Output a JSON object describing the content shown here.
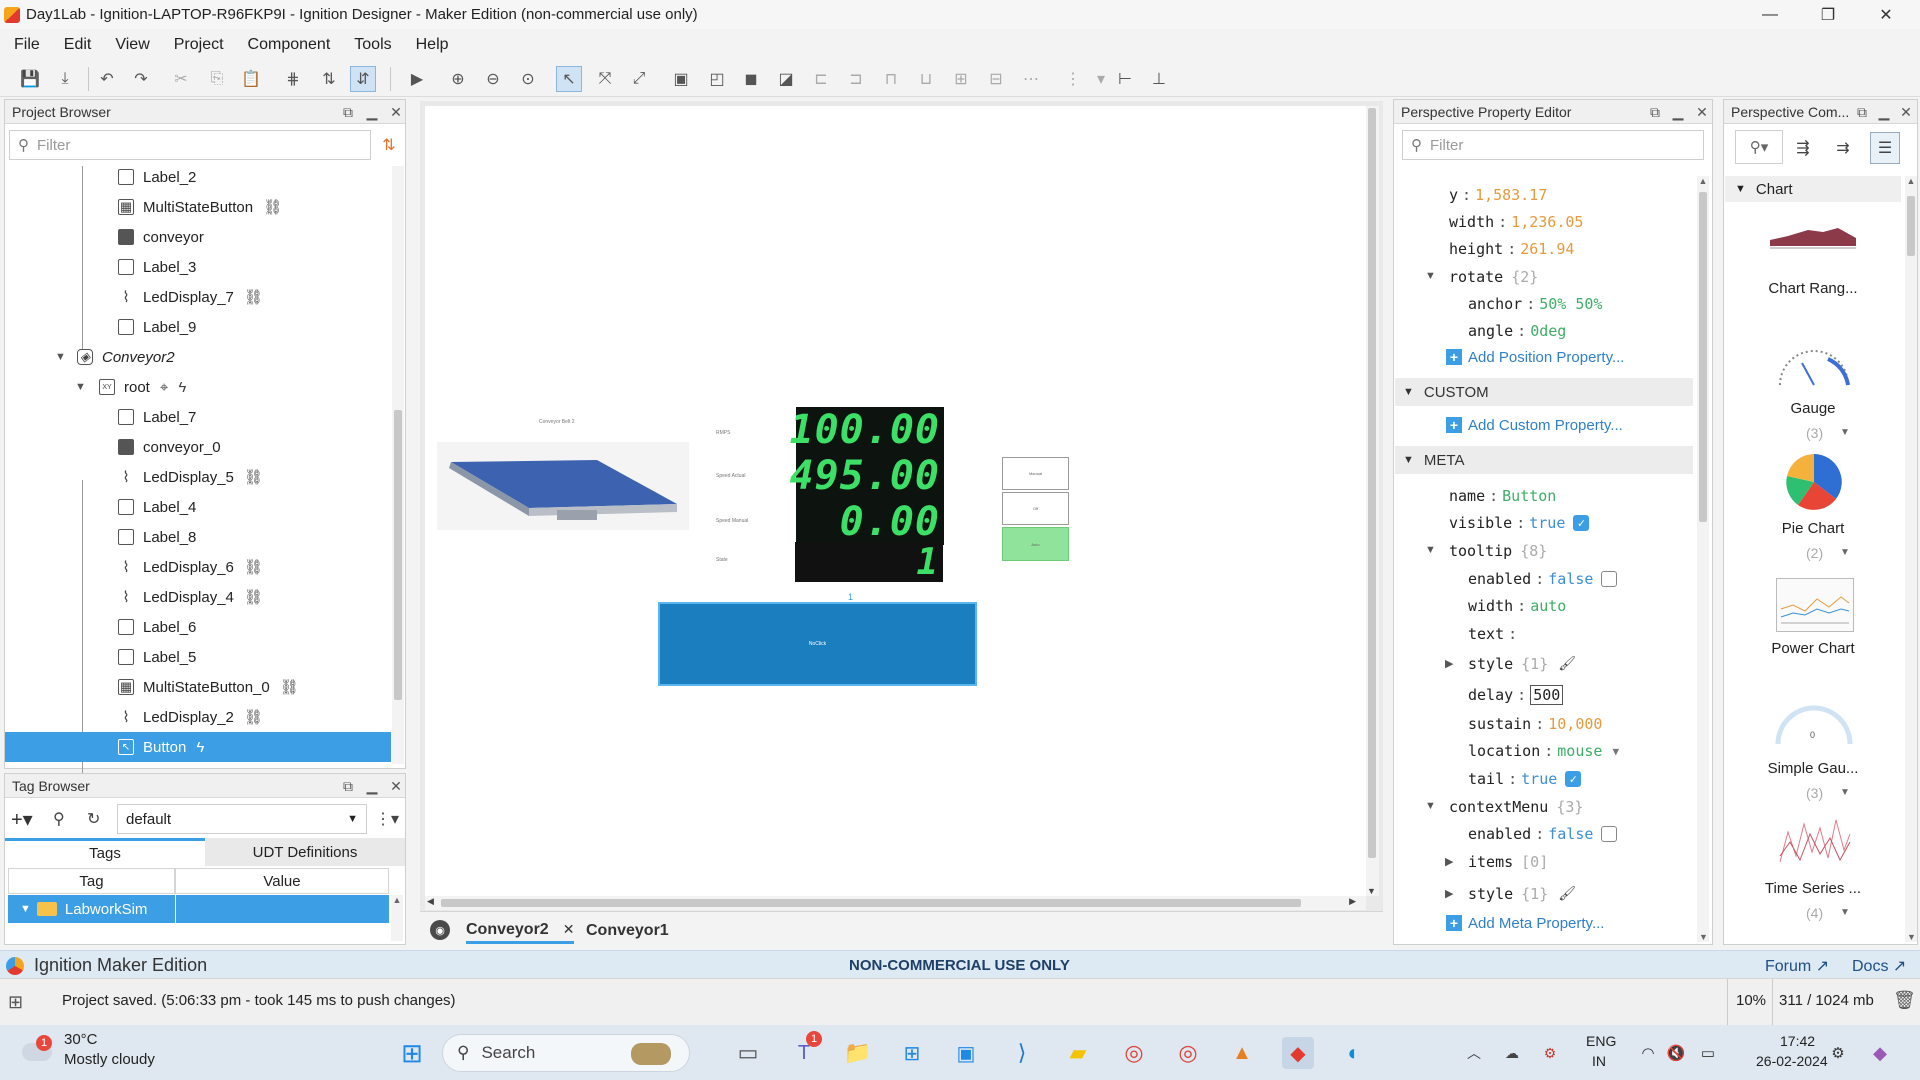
{
  "window": {
    "title": "Day1Lab - Ignition-LAPTOP-R96FKP9I - Ignition Designer - Maker Edition (non-commercial use only)",
    "controls": {
      "minimize": "—",
      "maximize": "❐",
      "close": "✕"
    }
  },
  "menubar": {
    "items": [
      {
        "label": "File"
      },
      {
        "label": "Edit"
      },
      {
        "label": "View"
      },
      {
        "label": "Project"
      },
      {
        "label": "Component"
      },
      {
        "label": "Tools"
      },
      {
        "label": "Help"
      }
    ]
  },
  "project_browser": {
    "title": "Project Browser",
    "filter_placeholder": "Filter",
    "items": [
      {
        "label": "Label_2",
        "icon": "label-icon"
      },
      {
        "label": "MultiStateButton",
        "icon": "multistate-icon",
        "link": true
      },
      {
        "label": "conveyor",
        "icon": "image-icon"
      },
      {
        "label": "Label_3",
        "icon": "label-icon"
      },
      {
        "label": "LedDisplay_7",
        "icon": "led-icon",
        "link": true
      },
      {
        "label": "Label_9",
        "icon": "label-icon"
      },
      {
        "label": "Conveyor2",
        "icon": "view-icon"
      },
      {
        "label": "root",
        "icon": "xy-container-icon"
      },
      {
        "label": "Label_7",
        "icon": "label-icon"
      },
      {
        "label": "conveyor_0",
        "icon": "image-icon"
      },
      {
        "label": "LedDisplay_5",
        "icon": "led-icon",
        "link": true
      },
      {
        "label": "Label_4",
        "icon": "label-icon"
      },
      {
        "label": "Label_8",
        "icon": "label-icon"
      },
      {
        "label": "LedDisplay_6",
        "icon": "led-icon",
        "link": true
      },
      {
        "label": "LedDisplay_4",
        "icon": "led-icon",
        "link": true
      },
      {
        "label": "Label_6",
        "icon": "label-icon"
      },
      {
        "label": "Label_5",
        "icon": "label-icon"
      },
      {
        "label": "MultiStateButton_0",
        "icon": "multistate-icon",
        "link": true
      },
      {
        "label": "LedDisplay_2",
        "icon": "led-icon",
        "link": true
      },
      {
        "label": "Button",
        "icon": "button-icon",
        "selected": true
      }
    ]
  },
  "tag_browser": {
    "title": "Tag Browser",
    "provider": "default",
    "tabs": [
      {
        "label": "Tags"
      },
      {
        "label": "UDT Definitions"
      }
    ],
    "columns": [
      "Tag",
      "Value"
    ],
    "rows": [
      {
        "tag": "LabworkSim",
        "value": ""
      }
    ]
  },
  "canvas": {
    "view_title": "Conveyor Belt 2",
    "labels": [
      "RMPS",
      "Speed Actual",
      "Speed Manual",
      "State"
    ],
    "led_values": [
      "100.00",
      "495.00",
      "0.00",
      "1"
    ],
    "buttons": [
      "Manual",
      "Off",
      "Auto"
    ],
    "selected_button_text": "NoClick",
    "selection_index": "1",
    "tabs": [
      {
        "label": "Conveyor2",
        "closable": "✕"
      },
      {
        "label": "Conveyor1"
      }
    ]
  },
  "property_editor": {
    "title": "Perspective Property Editor",
    "filter_placeholder": "Filter",
    "position": {
      "y": "1,583.17",
      "width": "1,236.05",
      "height": "261.94",
      "rotate_count": "{2}",
      "anchor": "50% 50%",
      "angle": "0deg",
      "add_label": "Add Position Property..."
    },
    "custom": {
      "title": "CUSTOM",
      "add_label": "Add Custom Property..."
    },
    "meta": {
      "title": "META",
      "name": "Button",
      "visible": "true",
      "tooltip_count": "{8}",
      "tooltip_enabled": "false",
      "tooltip_width": "auto",
      "tooltip_text": "",
      "style_count": "{1}",
      "delay": "500",
      "sustain": "10,000",
      "location": "mouse",
      "tail": "true",
      "context_count": "{3}",
      "context_enabled": "false",
      "items_count": "[0]",
      "context_style_count": "{1}",
      "add_label": "Add Meta Property..."
    },
    "keys": {
      "y": "y",
      "width": "width",
      "height": "height",
      "rotate": "rotate",
      "anchor": "anchor",
      "angle": "angle",
      "name": "name",
      "visible": "visible",
      "tooltip": "tooltip",
      "enabled": "enabled",
      "text": "text",
      "style": "style",
      "delay": "delay",
      "sustain": "sustain",
      "location": "location",
      "tail": "tail",
      "contextMenu": "contextMenu",
      "items": "items"
    }
  },
  "component_palette": {
    "title": "Perspective Com...",
    "category": "Chart",
    "items": [
      {
        "label": "Chart Rang...",
        "count": ""
      },
      {
        "label": "Gauge",
        "count": "(3)"
      },
      {
        "label": "Pie Chart",
        "count": "(2)"
      },
      {
        "label": "Power Chart",
        "count": ""
      },
      {
        "label": "Simple Gau...",
        "count": "(3)"
      },
      {
        "label": "Time Series ...",
        "count": "(4)"
      }
    ],
    "gauge_value": "0"
  },
  "brand_bar": {
    "product": "Ignition Maker Edition",
    "notice": "NON-COMMERCIAL USE ONLY",
    "forum": "Forum",
    "docs": "Docs"
  },
  "status_bar": {
    "message": "Project saved. (5:06:33 pm - took 145 ms to push changes)",
    "zoom": "10%",
    "memory": "311 / 1024 mb"
  },
  "taskbar": {
    "weather_temp": "30°C",
    "weather_desc": "Mostly cloudy",
    "weather_badge": "1",
    "search": "Search",
    "teams_badge": "1",
    "lang_top": "ENG",
    "lang_bottom": "IN",
    "time": "17:42",
    "date": "26-02-2024"
  },
  "colors": {
    "selection": "#3c9ee5",
    "led_green": "#3de067",
    "button_blue": "#1b7fbf",
    "auto_green": "#8fe39a",
    "prop_number": "#e79a3d",
    "prop_string": "#3fae65",
    "prop_bool": "#3c8fd6"
  }
}
